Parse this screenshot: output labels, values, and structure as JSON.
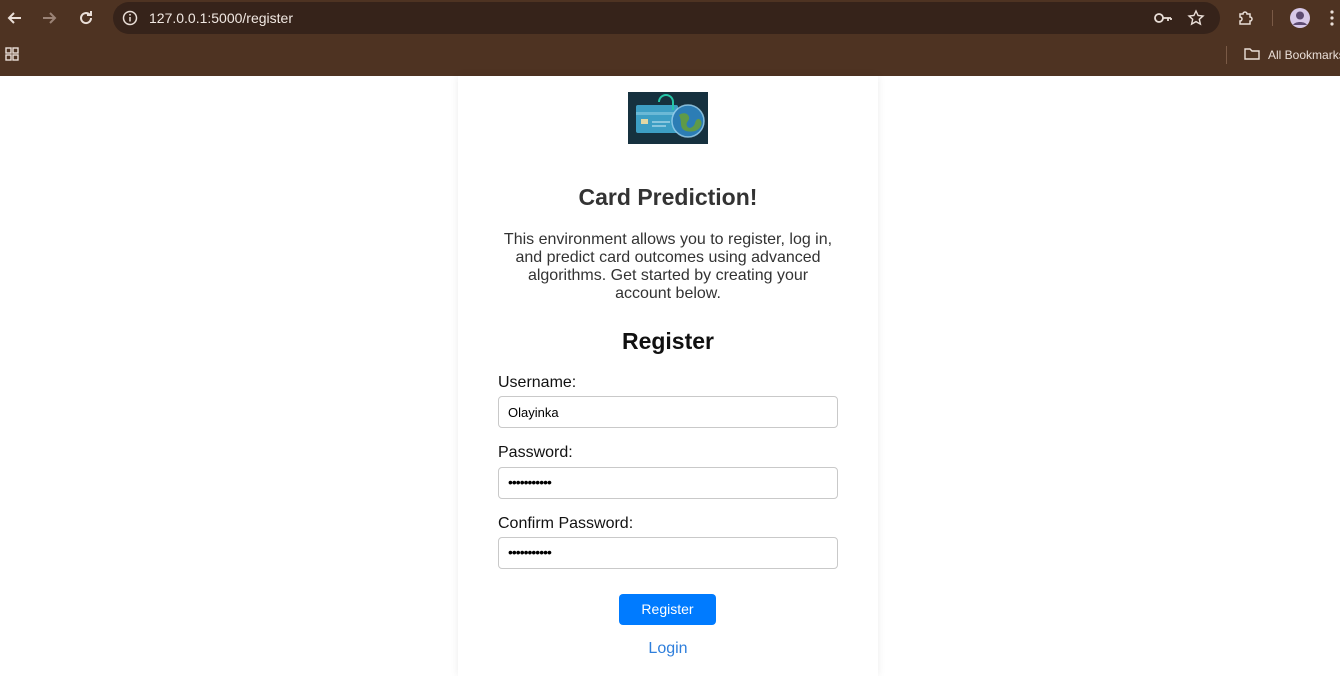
{
  "browser": {
    "url": "127.0.0.1:5000/register",
    "bookmarks_label": "All Bookmarks"
  },
  "page": {
    "title": "Card Prediction!",
    "description": "This environment allows you to register, log in, and predict card outcomes using advanced algorithms. Get started by creating your account below.",
    "form_heading": "Register",
    "fields": [
      {
        "label": "Username:",
        "value": "Olayinka"
      },
      {
        "label": "Password:",
        "value": "•••••••••••"
      },
      {
        "label": "Confirm Password:",
        "value": "•••••••••••"
      }
    ],
    "submit_label": "Register",
    "login_link": "Login"
  },
  "icons": {
    "back": "arrow-left",
    "forward": "arrow-right",
    "reload": "reload",
    "site_info": "info",
    "password": "key",
    "bookmark": "star",
    "extensions": "puzzle-piece",
    "profile": "avatar",
    "menu": "three-dots",
    "apps": "grid",
    "folder": "folder"
  },
  "colors": {
    "browser_frame": "#4e3322",
    "omnibox": "#36231a",
    "primary_button": "#007bff",
    "link": "#2f7fdc"
  }
}
